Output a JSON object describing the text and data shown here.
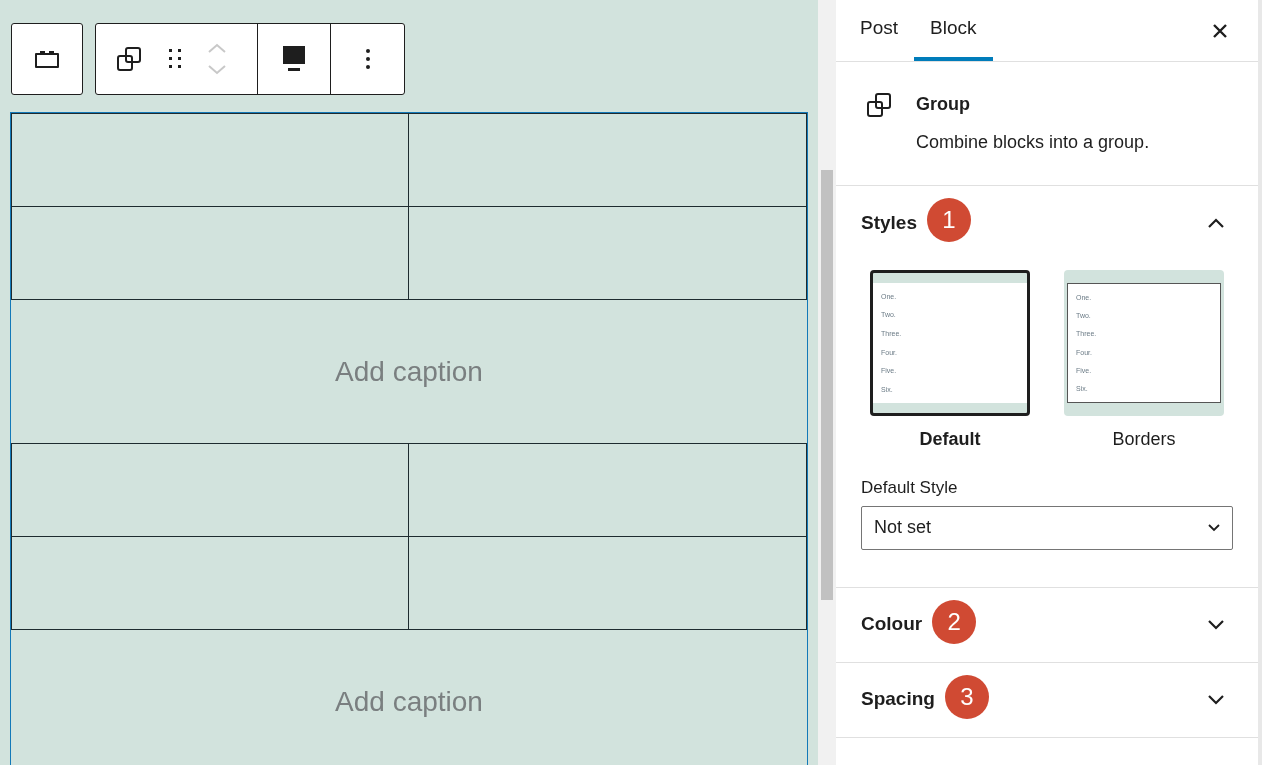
{
  "toolbar": {
    "move_disabled": true
  },
  "tables": [
    {
      "caption_placeholder": "Add caption"
    },
    {
      "caption_placeholder": "Add caption"
    }
  ],
  "sidebar": {
    "tabs": [
      {
        "label": "Post",
        "selected": false
      },
      {
        "label": "Block",
        "selected": true
      }
    ],
    "block": {
      "title": "Group",
      "description": "Combine blocks into a group."
    },
    "panels": [
      {
        "title": "Styles",
        "badge": "1",
        "expanded": true,
        "styles": [
          {
            "label": "Default",
            "selected": true,
            "preview_lines": [
              "One.",
              "Two.",
              "Three.",
              "Four.",
              "Five.",
              "Six."
            ]
          },
          {
            "label": "Borders",
            "selected": false,
            "preview_lines": [
              "One.",
              "Two.",
              "Three.",
              "Four.",
              "Five.",
              "Six."
            ]
          }
        ],
        "default_style": {
          "label": "Default Style",
          "value": "Not set"
        }
      },
      {
        "title": "Colour",
        "badge": "2",
        "expanded": false
      },
      {
        "title": "Spacing",
        "badge": "3",
        "expanded": false
      }
    ]
  }
}
